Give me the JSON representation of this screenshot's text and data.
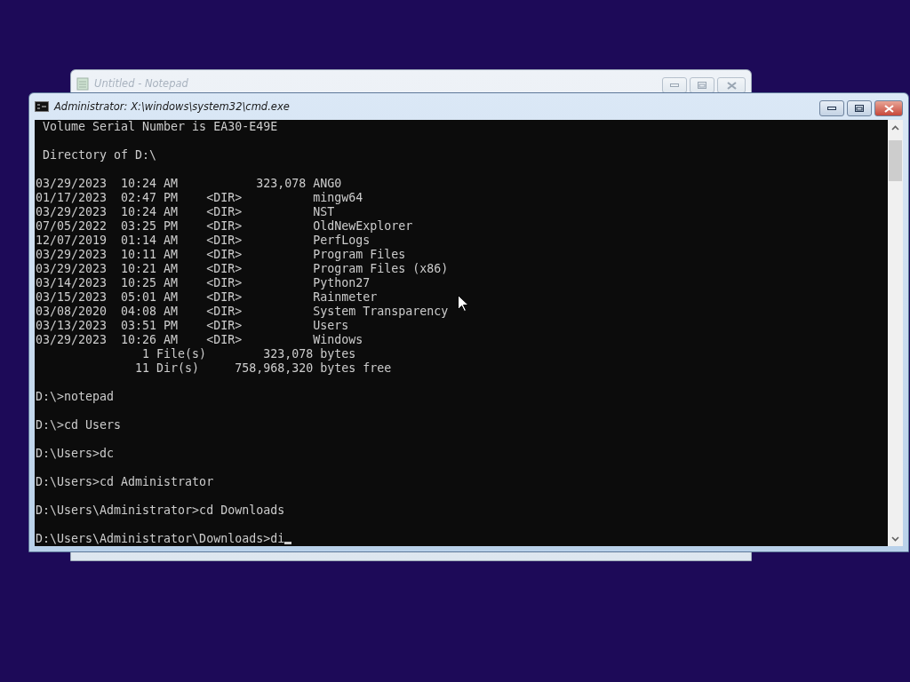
{
  "notepad_window": {
    "title": "Untitled - Notepad",
    "active": false
  },
  "console_window": {
    "title": "Administrator: X:\\windows\\system32\\cmd.exe",
    "active": true,
    "blocks": [
      [
        " Volume Serial Number is EA30-E49E"
      ],
      [
        " Directory of D:\\"
      ],
      [
        "03/29/2023  10:24 AM           323,078 ANG0",
        "01/17/2023  02:47 PM    <DIR>          mingw64",
        "03/29/2023  10:24 AM    <DIR>          NST",
        "07/05/2022  03:25 PM    <DIR>          OldNewExplorer",
        "12/07/2019  01:14 AM    <DIR>          PerfLogs",
        "03/29/2023  10:11 AM    <DIR>          Program Files",
        "03/29/2023  10:21 AM    <DIR>          Program Files (x86)",
        "03/14/2023  10:25 AM    <DIR>          Python27",
        "03/15/2023  05:01 AM    <DIR>          Rainmeter",
        "03/08/2020  04:08 AM    <DIR>          System Transparency",
        "03/13/2023  03:51 PM    <DIR>          Users",
        "03/29/2023  10:26 AM    <DIR>          Windows",
        "               1 File(s)        323,078 bytes",
        "              11 Dir(s)     758,968,320 bytes free"
      ],
      [
        "D:\\>notepad"
      ],
      [
        "D:\\>cd Users"
      ],
      [
        "D:\\Users>dc"
      ],
      [
        "D:\\Users>cd Administrator"
      ],
      [
        "D:\\Users\\Administrator>cd Downloads"
      ],
      [
        "D:\\Users\\Administrator\\Downloads>di"
      ]
    ]
  }
}
